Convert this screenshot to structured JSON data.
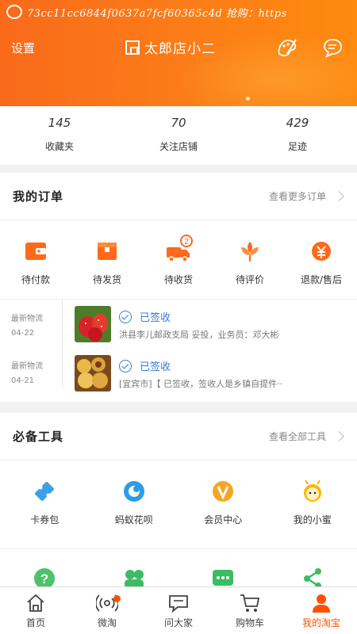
{
  "colors": {
    "brand": "#ff5000",
    "header_start": "#f96a1b",
    "header_end": "#ff8a10",
    "link_blue": "#3a7bd5"
  },
  "ticker": {
    "text": "73cc11cc6844f0637a7fcf60365c4d 抢购：https"
  },
  "header": {
    "settings": "设置",
    "shop_name": "太郎店小二",
    "icons": [
      "skin-icon",
      "message-icon"
    ]
  },
  "stats": [
    {
      "value": "145",
      "label": "收藏夹"
    },
    {
      "value": "70",
      "label": "关注店铺"
    },
    {
      "value": "429",
      "label": "足迹"
    }
  ],
  "orders": {
    "title": "我的订单",
    "more": "查看更多订单",
    "items": [
      {
        "label": "待付款",
        "icon": "wallet-icon"
      },
      {
        "label": "待发货",
        "icon": "box-icon"
      },
      {
        "label": "待收货",
        "icon": "truck-icon",
        "badge": "2"
      },
      {
        "label": "待评价",
        "icon": "flower-icon"
      },
      {
        "label": "退款/售后",
        "icon": "refund-icon"
      }
    ]
  },
  "logistics": [
    {
      "label": "最新物流",
      "date": "04-22",
      "status": "已签收",
      "detail": "洪县李儿邮政支局 妥投，业务员：邓大彬"
    },
    {
      "label": "最新物流",
      "date": "04-21",
      "status": "已签收",
      "detail": "[宜宾市]【 已签收，签收人是乡镇自提件··"
    }
  ],
  "tools": {
    "title": "必备工具",
    "more": "查看全部工具",
    "items": [
      {
        "label": "卡券包",
        "icon": "ticket-icon"
      },
      {
        "label": "蚂蚁花呗",
        "icon": "huabei-icon"
      },
      {
        "label": "会员中心",
        "icon": "vip-icon"
      },
      {
        "label": "我的小蜜",
        "icon": "assistant-icon"
      }
    ],
    "row2_icons": [
      "help-icon",
      "community-icon",
      "chat-icon",
      "share-icon"
    ]
  },
  "tabs": [
    {
      "label": "首页",
      "icon": "home-icon"
    },
    {
      "label": "微淘",
      "icon": "broadcast-icon"
    },
    {
      "label": "问大家",
      "icon": "question-icon"
    },
    {
      "label": "购物车",
      "icon": "cart-icon"
    },
    {
      "label": "我的淘宝",
      "icon": "profile-icon",
      "active": true
    }
  ]
}
